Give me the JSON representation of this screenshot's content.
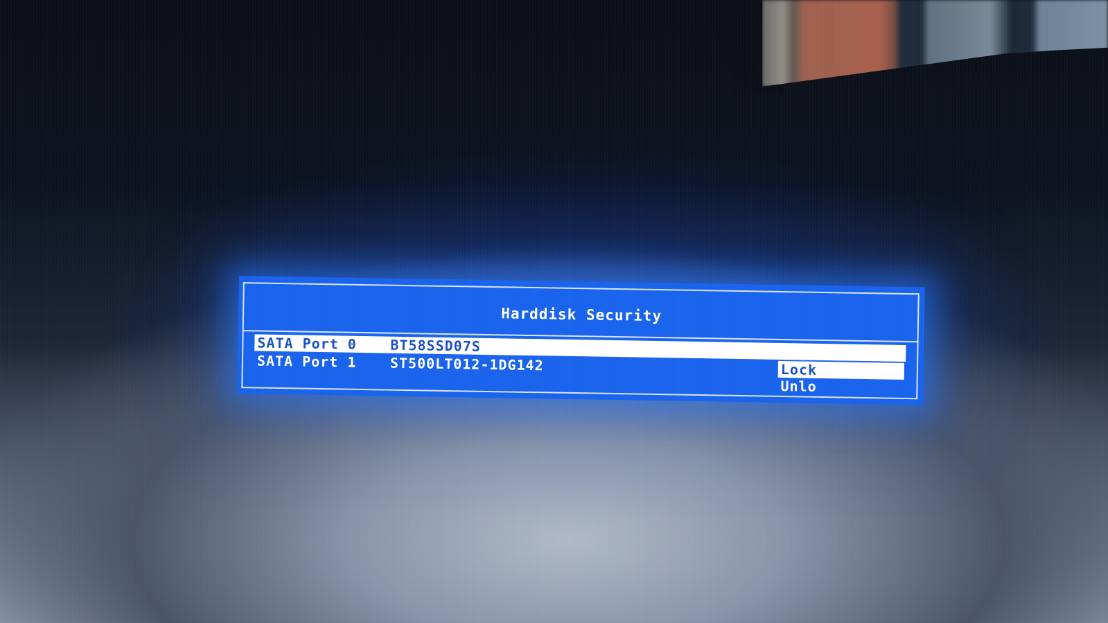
{
  "dialog": {
    "title": "Harddisk Security",
    "rows": [
      {
        "port": "SATA Port 0",
        "model": "BT58SSD07S"
      },
      {
        "port": "SATA Port 1",
        "model": "ST500LT012-1DG142"
      }
    ],
    "menu": {
      "lock_label": "Lock",
      "unlock_label": "Unlo"
    }
  },
  "colors": {
    "dialog_background": "#1a63ec",
    "highlight": "#ffffff",
    "text": "#ffffff",
    "highlight_text": "#1a4fc4"
  }
}
